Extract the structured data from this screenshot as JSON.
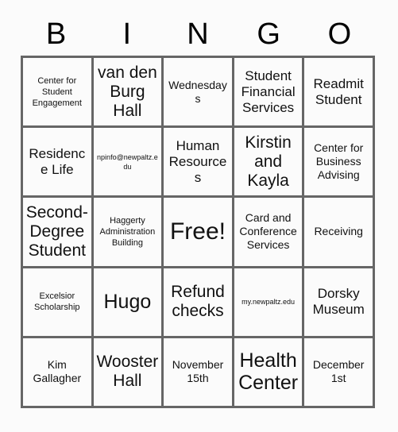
{
  "header": {
    "letters": [
      "B",
      "I",
      "N",
      "G",
      "O"
    ]
  },
  "grid": {
    "rows": 5,
    "columns": 5,
    "border_color": "#666666",
    "cell_background": "#fbfbfb",
    "text_color": "#111111",
    "cells": [
      {
        "text": "Center for Student Engagement",
        "size": "sm"
      },
      {
        "text": "van den Burg Hall",
        "size": "xl"
      },
      {
        "text": "Wednesdays",
        "size": "md"
      },
      {
        "text": "Student Financial Services",
        "size": "lg"
      },
      {
        "text": "Readmit Student",
        "size": "lg"
      },
      {
        "text": "Residence Life",
        "size": "lg"
      },
      {
        "text": "npinfo@newpaltz.edu",
        "size": "xs"
      },
      {
        "text": "Human Resources",
        "size": "lg"
      },
      {
        "text": "Kirstin and Kayla",
        "size": "xl"
      },
      {
        "text": "Center for Business Advising",
        "size": "md"
      },
      {
        "text": "Second-Degree Student",
        "size": "xl"
      },
      {
        "text": "Haggerty Administration Building",
        "size": "sm"
      },
      {
        "text": "Free!",
        "size": "free"
      },
      {
        "text": "Card and Conference Services",
        "size": "md"
      },
      {
        "text": "Receiving",
        "size": "md"
      },
      {
        "text": "Excelsior Scholarship",
        "size": "sm"
      },
      {
        "text": "Hugo",
        "size": "xxl"
      },
      {
        "text": "Refund checks",
        "size": "xl"
      },
      {
        "text": "my.newpaltz.edu",
        "size": "xs"
      },
      {
        "text": "Dorsky Museum",
        "size": "lg"
      },
      {
        "text": "Kim Gallagher",
        "size": "md"
      },
      {
        "text": "Wooster Hall",
        "size": "xl"
      },
      {
        "text": "November 15th",
        "size": "md"
      },
      {
        "text": "Health Center",
        "size": "xxl"
      },
      {
        "text": "December 1st",
        "size": "md"
      }
    ]
  }
}
